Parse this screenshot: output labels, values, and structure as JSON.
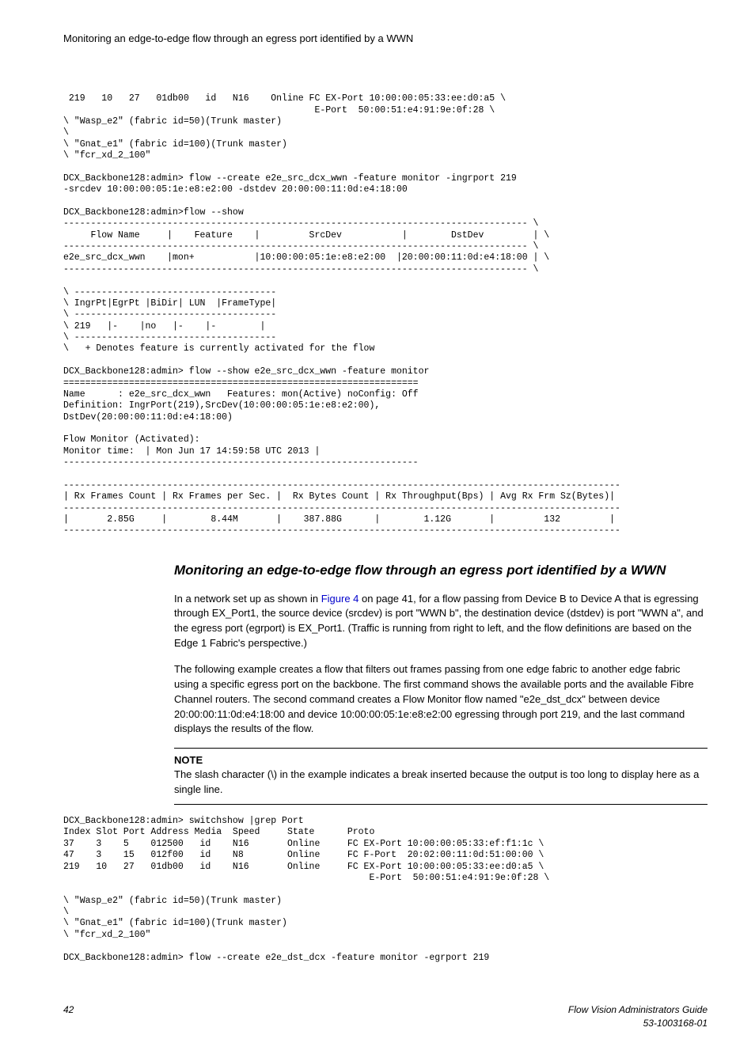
{
  "header": {
    "title": "Monitoring an edge-to-edge flow through an egress port identified by a WWN"
  },
  "code1": " 219   10   27   01db00   id   N16    Online FC EX-Port 10:00:00:05:33:ee:d0:a5 \\\n                                              E-Port  50:00:51:e4:91:9e:0f:28 \\\n\\ \"Wasp_e2\" (fabric id=50)(Trunk master)\n\\\n\\ \"Gnat_e1\" (fabric id=100)(Trunk master)\n\\ \"fcr_xd_2_100\"\n\nDCX_Backbone128:admin> flow --create e2e_src_dcx_wwn -feature monitor -ingrport 219\n-srcdev 10:00:00:05:1e:e8:e2:00 -dstdev 20:00:00:11:0d:e4:18:00\n\nDCX_Backbone128:admin>flow --show\n------------------------------------------------------------------------------------- \\\n     Flow Name     |    Feature    |         SrcDev           |        DstDev         | \\\n------------------------------------------------------------------------------------- \\\ne2e_src_dcx_wwn    |mon+           |10:00:00:05:1e:e8:e2:00  |20:00:00:11:0d:e4:18:00 | \\\n------------------------------------------------------------------------------------- \\\n\n\\ -------------------------------------\n\\ IngrPt|EgrPt |BiDir| LUN  |FrameType|\n\\ -------------------------------------\n\\ 219   |-    |no   |-    |-        |\n\\ -------------------------------------\n\\   + Denotes feature is currently activated for the flow\n\nDCX_Backbone128:admin> flow --show e2e_src_dcx_wwn -feature monitor\n=================================================================\nName      : e2e_src_dcx_wwn   Features: mon(Active) noConfig: Off\nDefinition: IngrPort(219),SrcDev(10:00:00:05:1e:e8:e2:00),\nDstDev(20:00:00:11:0d:e4:18:00)\n\nFlow Monitor (Activated):\nMonitor time:  | Mon Jun 17 14:59:58 UTC 2013 |\n-----------------------------------------------------------------\n\n------------------------------------------------------------------------------------------------------\n| Rx Frames Count | Rx Frames per Sec. |  Rx Bytes Count | Rx Throughput(Bps) | Avg Rx Frm Sz(Bytes)|\n------------------------------------------------------------------------------------------------------\n|       2.85G     |        8.44M       |    387.88G      |        1.12G       |         132         |\n------------------------------------------------------------------------------------------------------",
  "section": {
    "heading": "Monitoring an edge-to-edge flow through an egress port identified by a WWN",
    "para1a": "In a network set up as shown in ",
    "figlink": "Figure 4",
    "para1b": " on page 41, for a flow passing from Device B to Device A that is egressing through EX_Port1, the source device (srcdev) is port \"WWN b\", the destination device (dstdev) is port \"WWN a\", and the egress port (egrport) is EX_Port1. (Traffic is running from right to left, and the flow definitions are based on the Edge 1 Fabric's perspective.)",
    "para2": "The following example creates a flow that filters out frames passing from one edge fabric to another edge fabric using a specific egress port on the backbone. The first command shows the available ports and the available Fibre Channel routers. The second command creates a Flow Monitor flow named \"e2e_dst_dcx\" between device 20:00:00:11:0d:e4:18:00 and device 10:00:00:05:1e:e8:e2:00 egressing through port 219, and the last command displays the results of the flow."
  },
  "note": {
    "label": "NOTE",
    "text": "The slash character (\\) in the example indicates a break inserted because the output is too long to display here as a single line."
  },
  "code2": "DCX_Backbone128:admin> switchshow |grep Port\nIndex Slot Port Address Media  Speed     State      Proto\n37    3    5    012500   id    N16       Online     FC EX-Port 10:00:00:05:33:ef:f1:1c \\\n47    3    15   012f00   id    N8        Online     FC F-Port  20:02:00:11:0d:51:00:00 \\\n219   10   27   01db00   id    N16       Online     FC EX-Port 10:00:00:05:33:ee:d0:a5 \\\n                                                        E-Port  50:00:51:e4:91:9e:0f:28 \\\n\n\\ \"Wasp_e2\" (fabric id=50)(Trunk master)\n\\\n\\ \"Gnat_e1\" (fabric id=100)(Trunk master)\n\\ \"fcr_xd_2_100\"\n\nDCX_Backbone128:admin> flow --create e2e_dst_dcx -feature monitor -egrport 219",
  "footer": {
    "page": "42",
    "guide": "Flow Vision Administrators Guide",
    "docnum": "53-1003168-01"
  }
}
